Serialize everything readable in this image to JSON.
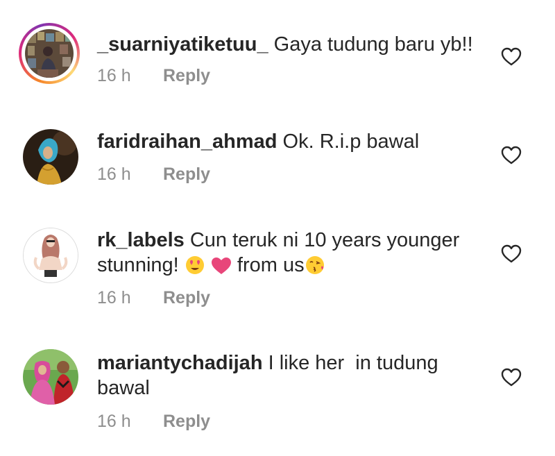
{
  "comments": [
    {
      "username": "_suarniyatiketuu_",
      "text": "Gaya tudung baru yb!!",
      "time": "16 h",
      "reply_label": "Reply"
    },
    {
      "username": "faridraihan_ahmad",
      "text": "Ok. R.i.p bawal",
      "time": "16 h",
      "reply_label": "Reply"
    },
    {
      "username": "rk_labels",
      "text_line1": "Cun teruk ni 10 years younger",
      "text_line2a": "stunning!",
      "text_line2b": "from us",
      "time": "16 h",
      "reply_label": "Reply"
    },
    {
      "username": "mariantychadijah",
      "text_line1": "I like her  in tudung",
      "text_line2": "bawal",
      "time": "16 h",
      "reply_label": "Reply"
    }
  ],
  "icons": {
    "like": "heart-outline-icon",
    "emoji_love": "smiling-face-heart-eyes-icon",
    "emoji_heart": "pink-heart-icon",
    "emoji_kiss": "face-blowing-kiss-icon"
  },
  "colors": {
    "text": "#262626",
    "secondary": "#8e8e8e",
    "heart_emoji": "#e8467a",
    "emoji_yellow": "#ffcc33"
  }
}
